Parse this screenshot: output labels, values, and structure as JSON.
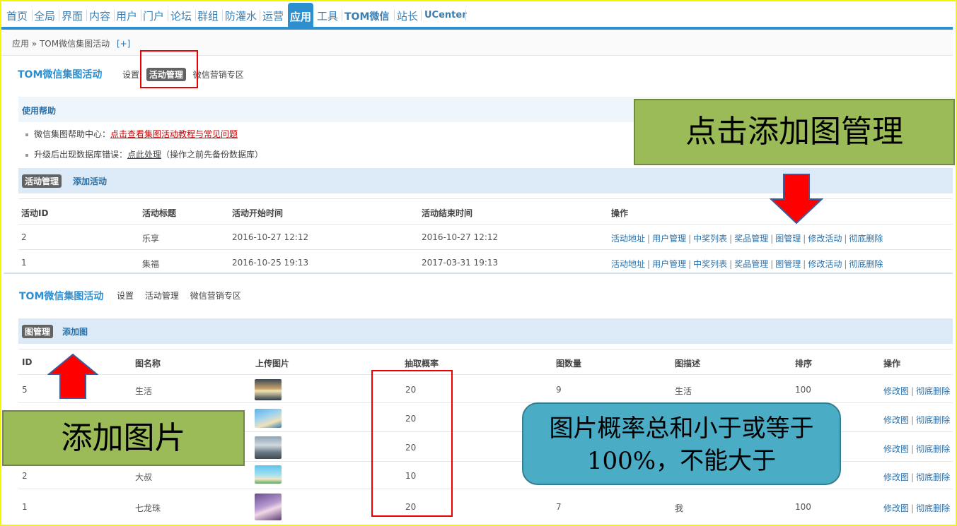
{
  "topnav": {
    "items": [
      "首页",
      "全局",
      "界面",
      "内容",
      "用户",
      "门户",
      "论坛",
      "群组",
      "防灌水",
      "运营",
      "应用",
      "工具",
      "TOM微信",
      "站长",
      "UCenter"
    ],
    "active": "应用"
  },
  "breadcrumb": {
    "path": "应用 » TOM微信集图活动",
    "plus": "[+]"
  },
  "panel1": {
    "brand": "TOM微信集图活动",
    "subnav": {
      "settings": "设置",
      "activity_mgmt": "活动管理",
      "marketing": "微信营销专区"
    },
    "help": {
      "title": "使用帮助",
      "line1_label": "微信集图帮助中心：",
      "line1_link": "点击查看集图活动教程与常见问题",
      "line2_label": "升级后出现数据库错误：",
      "line2_link": "点此处理",
      "line2_note": "（操作之前先备份数据库）"
    },
    "tabs": {
      "active": "活动管理",
      "add": "添加活动"
    },
    "table": {
      "headers": [
        "活动ID",
        "活动标题",
        "活动开始时间",
        "活动结束时间",
        "操作"
      ],
      "rows": [
        {
          "id": "2",
          "title": "乐享",
          "start": "2016-10-27 12:12",
          "end": "2016-10-27 12:12"
        },
        {
          "id": "1",
          "title": "集福",
          "start": "2016-10-25 19:13",
          "end": "2017-03-31 19:13"
        }
      ],
      "ops": [
        "活动地址",
        "用户管理",
        "中奖列表",
        "奖品管理",
        "图管理",
        "修改活动",
        "彻底删除"
      ]
    }
  },
  "panel2": {
    "brand": "TOM微信集图活动",
    "subnav": {
      "settings": "设置",
      "activity_mgmt": "活动管理",
      "marketing": "微信营销专区"
    },
    "tabs": {
      "active": "图管理",
      "add": "添加图"
    },
    "table": {
      "headers": [
        "ID",
        "图名称",
        "上传图片",
        "抽取概率",
        "图数量",
        "图描述",
        "排序",
        "操作"
      ],
      "rows": [
        {
          "id": "5",
          "name": "生活",
          "prob": "20",
          "count": "9",
          "desc": "生活",
          "sort": "100"
        },
        {
          "id": "",
          "name": "",
          "prob": "20",
          "count": "",
          "desc": "",
          "sort": ""
        },
        {
          "id": "",
          "name": "",
          "prob": "20",
          "count": "",
          "desc": "",
          "sort": ""
        },
        {
          "id": "2",
          "name": "大叔",
          "prob": "10",
          "count": "",
          "desc": "",
          "sort": ""
        },
        {
          "id": "1",
          "name": "七龙珠",
          "prob": "20",
          "count": "7",
          "desc": "我",
          "sort": "100"
        }
      ],
      "ops": [
        "修改图",
        "彻底删除"
      ]
    }
  },
  "callouts": {
    "top_right": "点击添加图管理",
    "bottom_left": "添加图片",
    "blue_line1": "图片概率总和小于或等于",
    "blue_line2": "100%，不能大于"
  },
  "colors": {
    "accent": "#2d8fd0",
    "link": "#2a6fa8",
    "green_callout": "#9bbb59",
    "blue_callout": "#4bacc6",
    "arrow": "#ff0000"
  }
}
